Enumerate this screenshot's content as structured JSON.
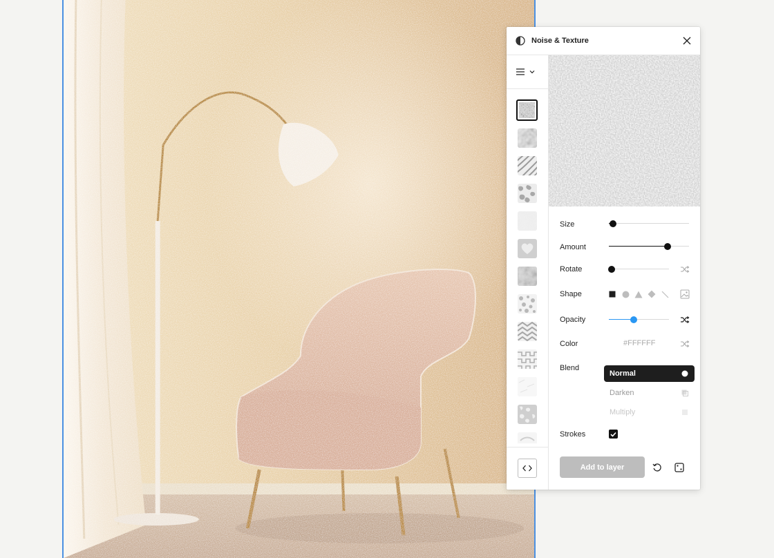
{
  "panel": {
    "title": "Noise & Texture",
    "logo_icon": "half-circle-logo-icon",
    "close_icon": "close-icon"
  },
  "sidebar": {
    "menu_icon": "hamburger-menu-icon",
    "menu_chevron_icon": "chevron-down-icon",
    "code_icon": "code-brackets-icon",
    "presets": [
      {
        "name": "preset-noise-splotch",
        "selected": true
      },
      {
        "name": "preset-soft-cloud"
      },
      {
        "name": "preset-diagonal-waves"
      },
      {
        "name": "preset-camo"
      },
      {
        "name": "preset-light-cloud"
      },
      {
        "name": "preset-heart"
      },
      {
        "name": "preset-dark-cloud"
      },
      {
        "name": "preset-spots"
      },
      {
        "name": "preset-chevrons"
      },
      {
        "name": "preset-zigzag"
      },
      {
        "name": "preset-faint"
      },
      {
        "name": "preset-marble"
      },
      {
        "name": "preset-partial"
      }
    ]
  },
  "controls": {
    "size": {
      "label": "Size",
      "value": 0.05
    },
    "amount": {
      "label": "Amount",
      "value": 0.73
    },
    "rotate": {
      "label": "Rotate",
      "value": 0.05
    },
    "shape": {
      "label": "Shape",
      "options": [
        "square-shape-icon",
        "circle-shape-icon",
        "triangle-shape-icon",
        "diamond-shape-icon",
        "line-shape-icon"
      ],
      "selected": "square-shape-icon",
      "image_icon": "image-icon"
    },
    "opacity": {
      "label": "Opacity",
      "value": 0.41
    },
    "color": {
      "label": "Color",
      "value": "#FFFFFF"
    },
    "blend": {
      "label": "Blend",
      "options": [
        "Normal",
        "Darken",
        "Multiply"
      ],
      "selected": "Normal"
    },
    "strokes": {
      "label": "Strokes",
      "checked": true
    },
    "shuffle_icon": "shuffle-icon"
  },
  "footer": {
    "add_label": "Add to layer",
    "reset_icon": "reset-icon",
    "randomize_icon": "dice-icon"
  },
  "colors": {
    "accent": "#2a97f3",
    "selection_frame": "#4a90e2",
    "dark": "#1e1e1e",
    "disabled_button": "#bdbdbd"
  }
}
